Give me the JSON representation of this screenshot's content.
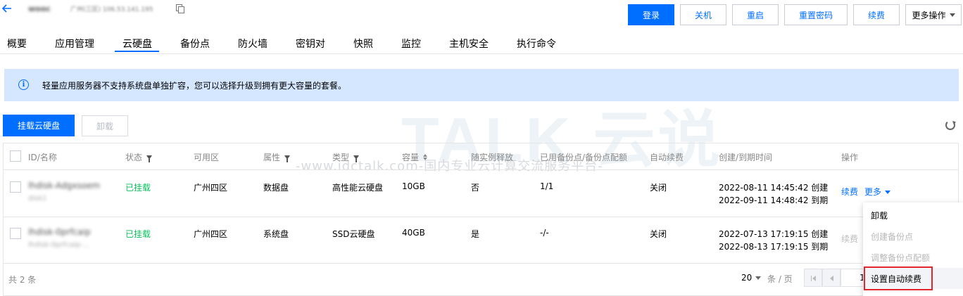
{
  "header": {
    "instance_name": "wooc",
    "instance_meta": "广州(三区) 106.53.141.195",
    "buttons": {
      "login": "登录",
      "shutdown": "关机",
      "restart": "重启",
      "reset_password": "重置密码",
      "renew": "续费",
      "more": "更多操作"
    }
  },
  "tabs": [
    "概要",
    "应用管理",
    "云硬盘",
    "备份点",
    "防火墙",
    "密钥对",
    "快照",
    "监控",
    "主机安全",
    "执行命令"
  ],
  "active_tab": "云硬盘",
  "notice": "轻量应用服务器不支持系统盘单独扩容，您可以选择升级到拥有更大容量的套餐。",
  "actions": {
    "mount": "挂载云硬盘",
    "unmount": "卸载"
  },
  "watermark": {
    "logo": "TALK 云说",
    "sub": "-www.idctalk.com-国内专业云计算交流服务平台-"
  },
  "table": {
    "columns": {
      "id_name": "ID/名称",
      "status": "状态",
      "zone": "可用区",
      "attribute": "属性",
      "type": "类型",
      "capacity": "容量",
      "release_with_instance": "随实例释放",
      "backup_quota": "已用备份点/备份点配额",
      "auto_renew": "自动续费",
      "created_expire": "创建/到期时间",
      "operation": "操作"
    },
    "rows": [
      {
        "id": "lhdisk-Adgxsoem",
        "name": "disk1",
        "status": "已挂载",
        "zone": "广州四区",
        "attribute": "数据盘",
        "type": "高性能云硬盘",
        "capacity": "10GB",
        "release_with_instance": "否",
        "backup_quota": "1/1",
        "auto_renew": "关闭",
        "created": "2022-08-11 14:45:42 创建",
        "expire": "2022-09-11 14:48:42 到期",
        "renew": "续费",
        "more": "更多"
      },
      {
        "id": "lhdisk-0prfcaip",
        "name": "lhdisk-0prfcaip-...",
        "status": "已挂载",
        "zone": "广州四区",
        "attribute": "系统盘",
        "type": "SSD云硬盘",
        "capacity": "40GB",
        "release_with_instance": "是",
        "backup_quota": "-/-",
        "auto_renew": "关闭",
        "created": "2022-07-13 17:19:15 创建",
        "expire": "2022-08-13 17:19:15 到期",
        "renew": "续费"
      }
    ]
  },
  "footer": {
    "total": "共 2 条",
    "page_size": "20",
    "per_page_label": "条 / 页",
    "current_page": "1"
  },
  "dropdown": {
    "items": [
      {
        "label": "卸载",
        "enabled": true
      },
      {
        "label": "创建备份点",
        "enabled": false
      },
      {
        "label": "调整备份点配额",
        "enabled": false
      },
      {
        "label": "设置自动续费",
        "enabled": true,
        "highlighted": true
      }
    ]
  },
  "colors": {
    "primary": "#006eff",
    "success": "#0abf5b",
    "notice_bg": "#d5e7ff",
    "highlight_border": "#e3262e"
  }
}
